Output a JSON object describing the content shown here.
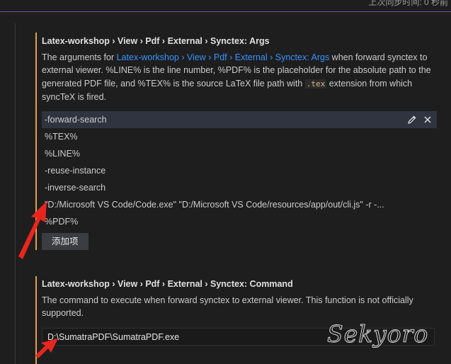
{
  "header": {
    "sync_status": "上次同步时间: 0 秒前"
  },
  "args_setting": {
    "title_category": "Latex-workshop › View › Pdf › External › Synctex: ",
    "title_name": "Args",
    "desc_before": "The arguments for ",
    "desc_link": "Latex-workshop › View › Pdf › External › Synctex: Args",
    "desc_middle": " when forward synctex to external viewer. %LINE% is the line number, %PDF% is the placeholder for the absolute path to the generated PDF file, and %TEX% is the source LaTeX file path with ",
    "desc_code": ".tex",
    "desc_after": " extension from which syncTeX is fired.",
    "items": [
      "-forward-search",
      "%TEX%",
      "%LINE%",
      "-reuse-instance",
      "-inverse-search",
      "\"D:/Microsoft VS Code/Code.exe\" \"D:/Microsoft VS Code/resources/app/out/cli.js\" -r -...",
      "%PDF%"
    ],
    "add_item_label": "添加项",
    "edit_icon": "pencil-icon",
    "remove_icon": "close-icon"
  },
  "command_setting": {
    "title_category": "Latex-workshop › View › Pdf › External › Synctex: ",
    "title_name": "Command",
    "desc": "The command to execute when forward synctex to external viewer. This function is not officially supported.",
    "value": "D:\\SumatraPDF\\SumatraPDF.exe"
  },
  "watermark": "Sekyoro",
  "colors": {
    "modified_bar": "#e2a04a",
    "link": "#3794ff",
    "arrow": "#e8261f"
  }
}
